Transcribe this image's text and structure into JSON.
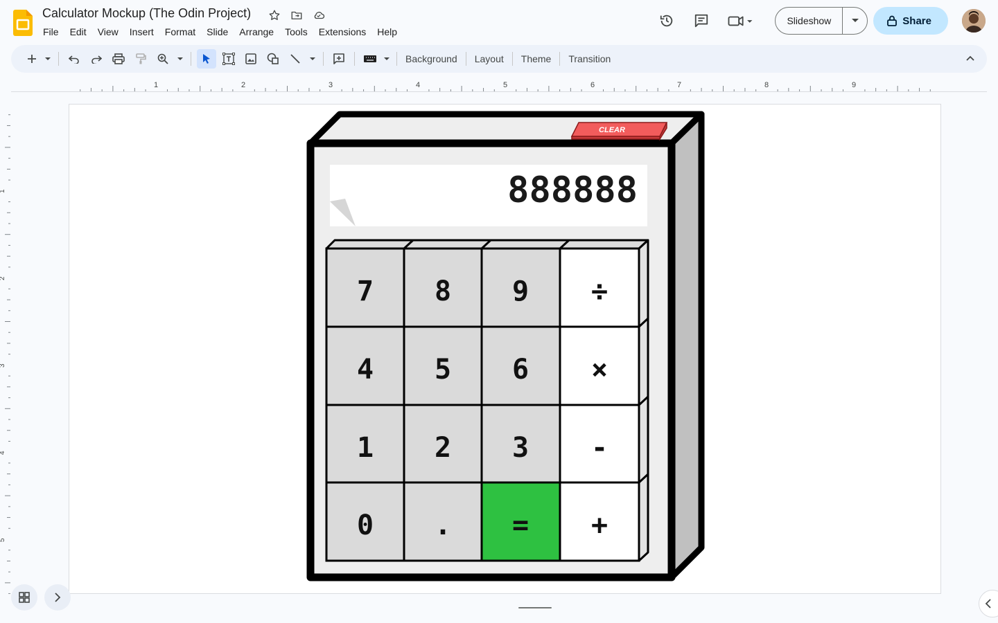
{
  "app": {
    "title": "Calculator Mockup (The Odin Project)",
    "menu": [
      "File",
      "Edit",
      "View",
      "Insert",
      "Format",
      "Slide",
      "Arrange",
      "Tools",
      "Extensions",
      "Help"
    ],
    "slideshow_label": "Slideshow",
    "share_label": "Share"
  },
  "toolbar": {
    "background_label": "Background",
    "layout_label": "Layout",
    "theme_label": "Theme",
    "transition_label": "Transition"
  },
  "ruler": {
    "h_labels": [
      "1",
      "2",
      "3",
      "4",
      "5",
      "6",
      "7",
      "8",
      "9"
    ],
    "v_labels": [
      "1",
      "2",
      "3",
      "4",
      "5"
    ]
  },
  "calculator": {
    "clear_label": "CLEAR",
    "display_value": "888888",
    "keys": [
      [
        "7",
        "8",
        "9",
        "÷"
      ],
      [
        "4",
        "5",
        "6",
        "×"
      ],
      [
        "1",
        "2",
        "3",
        "-"
      ],
      [
        "0",
        ".",
        "=",
        "+"
      ]
    ],
    "colors": {
      "number_key": "#dadada",
      "operator_key": "#ffffff",
      "equals_key": "#2ec141",
      "clear_button": "#f25c5c",
      "body": "#eeeeee",
      "side": "#c0c0c0",
      "outline": "#000000"
    }
  },
  "colors": {
    "app_background": "#f8fafd",
    "toolbar_background": "#edf2fa",
    "share_button": "#c2e7ff",
    "slides_logo": "#fbbc04"
  }
}
